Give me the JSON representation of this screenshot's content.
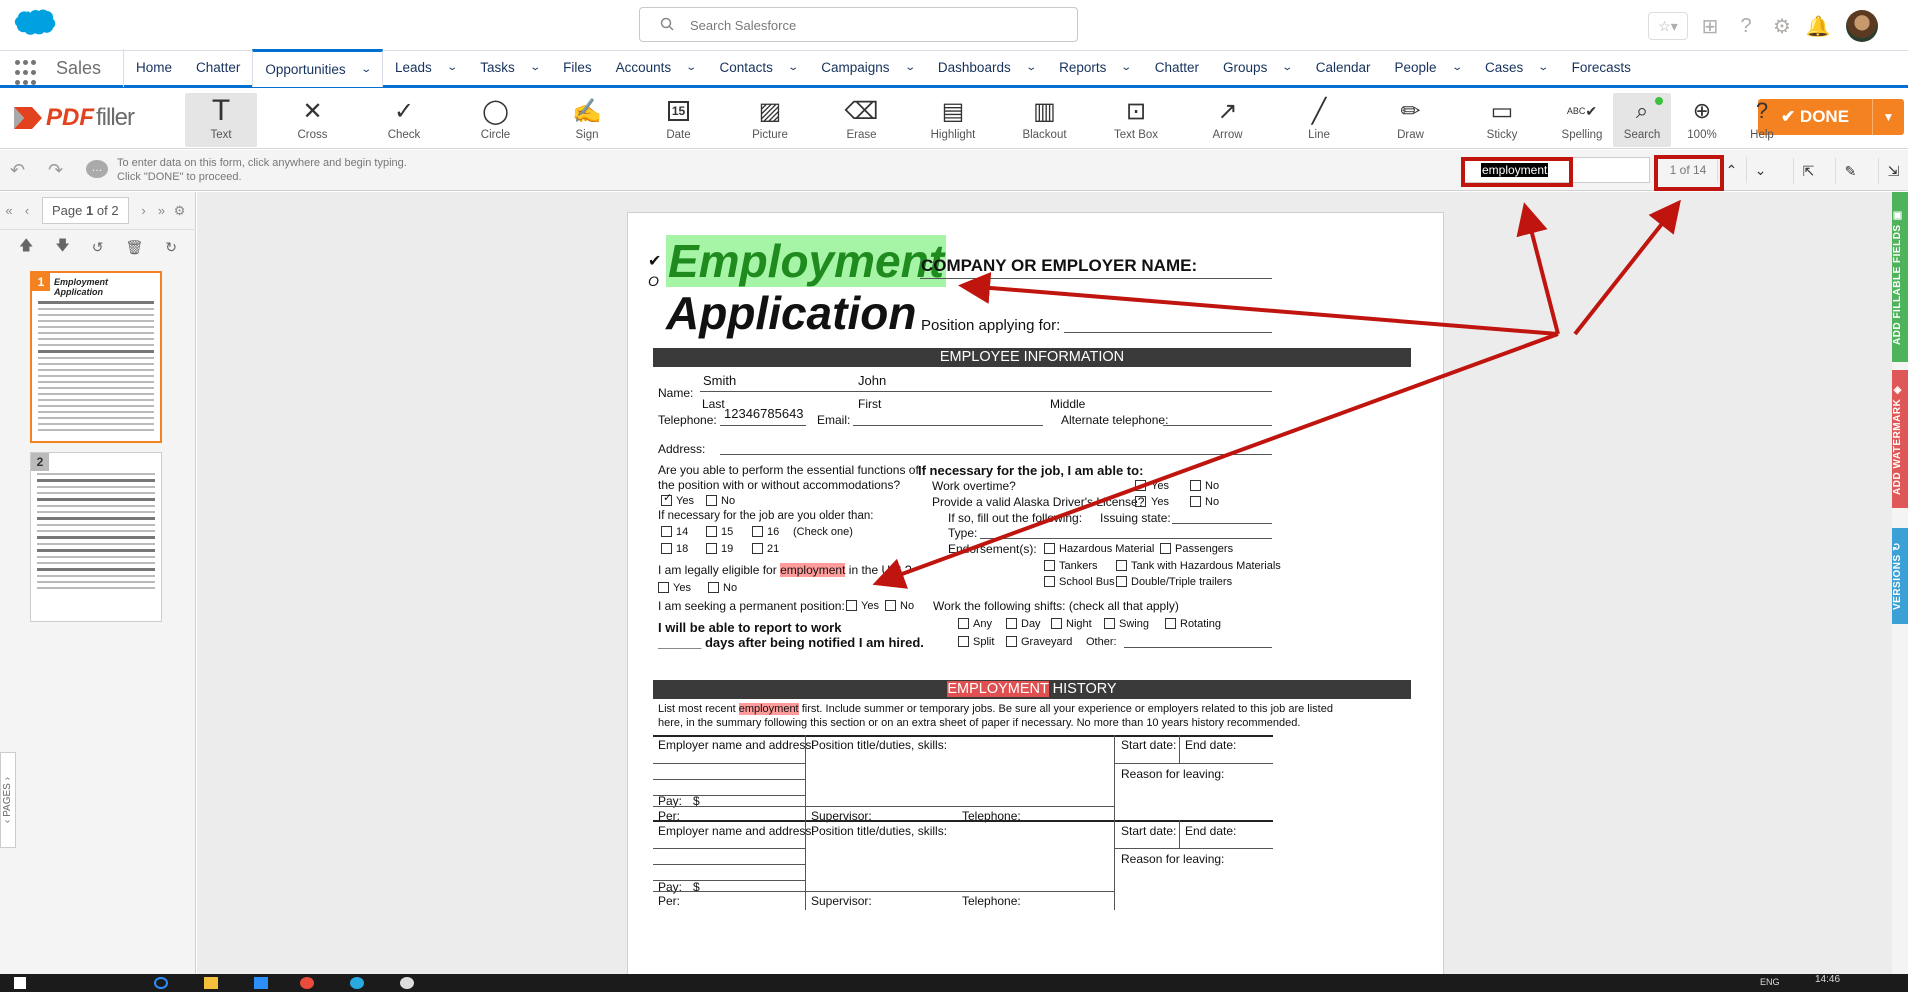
{
  "header": {
    "search_placeholder": "Search Salesforce",
    "app_name": "Sales"
  },
  "nav": [
    {
      "label": "Home",
      "dropdown": false
    },
    {
      "label": "Chatter",
      "dropdown": false
    },
    {
      "label": "Opportunities",
      "dropdown": true,
      "active": true
    },
    {
      "label": "Leads",
      "dropdown": true
    },
    {
      "label": "Tasks",
      "dropdown": true
    },
    {
      "label": "Files",
      "dropdown": false
    },
    {
      "label": "Accounts",
      "dropdown": true
    },
    {
      "label": "Contacts",
      "dropdown": true
    },
    {
      "label": "Campaigns",
      "dropdown": true
    },
    {
      "label": "Dashboards",
      "dropdown": true
    },
    {
      "label": "Reports",
      "dropdown": true
    },
    {
      "label": "Chatter",
      "dropdown": false
    },
    {
      "label": "Groups",
      "dropdown": true
    },
    {
      "label": "Calendar",
      "dropdown": false
    },
    {
      "label": "People",
      "dropdown": true
    },
    {
      "label": "Cases",
      "dropdown": true
    },
    {
      "label": "Forecasts",
      "dropdown": false
    }
  ],
  "pdffiller": {
    "logo_pdf": "PDF",
    "logo_filler": "filler",
    "tools": [
      "Text",
      "Cross",
      "Check",
      "Circle",
      "Sign",
      "Date",
      "Picture",
      "Erase",
      "Highlight",
      "Blackout",
      "Text Box",
      "Arrow",
      "Line",
      "Draw",
      "Sticky"
    ],
    "right_tools": [
      "Spelling",
      "Search",
      "100%",
      "Help"
    ],
    "spelling_badge": "ABC",
    "date_icon_num": "15",
    "done_label": "DONE",
    "hint_line1": "To enter data on this form, click anywhere and begin typing.",
    "hint_line2": "Click \"DONE\" to proceed.",
    "search_value": "employment",
    "search_count": "1 of 14"
  },
  "left_panel": {
    "page_label": "Page",
    "page_current": "1",
    "page_of": "of 2",
    "pages_tab": "PAGES",
    "thumb_numbers": [
      "1",
      "2"
    ],
    "thumb1_title_a": "Employment",
    "thumb1_title_b": "Application"
  },
  "right_tabs": [
    "ADD FILLABLE FIELDS",
    "ADD WATERMARK",
    "VERSIONS"
  ],
  "right_tab_colors": [
    "#4fb35b",
    "#e05757",
    "#3aa0d5"
  ],
  "doc": {
    "title1": "Employment",
    "title2": "Application",
    "employer_label": "COMPANY OR EMPLOYER NAME:",
    "position_label": "Position applying for:",
    "section1": "EMPLOYEE INFORMATION",
    "name_label": "Name:",
    "last_value": "Smith",
    "first_value": "John",
    "last": "Last",
    "first": "First",
    "middle": "Middle",
    "telephone_label": "Telephone:",
    "telephone_value": "12346785643",
    "email_label": "Email:",
    "alt_phone_label": "Alternate telephone:",
    "address_label": "Address:",
    "q_able_1": "Are you able to perform the essential functions of",
    "q_able_2": "the position with or without accommodations?",
    "yes": "Yes",
    "no": "No",
    "q_older": "If necessary for the job are you older than:",
    "ages": [
      "14",
      "15",
      "16",
      "18",
      "19",
      "21"
    ],
    "check_one": "(Check one)",
    "q_eligible_a": "I am legally eligible for",
    "q_eligible_hl": "employment",
    "q_eligible_b": "in the U.S.?",
    "q_permanent": "I am seeking a permanent position:",
    "report_1": "I will be able to report to work",
    "report_2": "______ days after being notified I am hired.",
    "job_head": "If necessary for the job, I am able to:",
    "overtime": "Work overtime?",
    "license": "Provide a valid Alaska Driver's License?",
    "fill_out": "If so, fill out the following:",
    "issuing": "Issuing state:",
    "type": "Type:",
    "endorse": "Endorsement(s):",
    "endorsements": [
      "Hazardous Material",
      "Passengers",
      "Tankers",
      "Tank with Hazardous Materials",
      "School Bus",
      "Double/Triple trailers"
    ],
    "shifts_label": "Work the following shifts: (check all that apply)",
    "shifts": [
      "Any",
      "Day",
      "Night",
      "Swing",
      "Rotating",
      "Split",
      "Graveyard"
    ],
    "other": "Other:",
    "section2_hl": "EMPLOYMENT",
    "section2_rest": "HISTORY",
    "list_a": "List most recent",
    "list_hl": "employment",
    "list_b": "first. Include summer or temporary jobs. Be sure all your experience or employers related to this job are listed",
    "list_c": "here, in the summary following this section or on an extra sheet of paper if necessary. No more than 10 years history recommended.",
    "emp_name": "Employer name and address:",
    "position_duties": "Position title/duties, skills:",
    "start": "Start date:",
    "end": "End date:",
    "reason": "Reason for leaving:",
    "pay": "Pay:",
    "dollar": "$",
    "per": "Per:",
    "supervisor": "Supervisor:",
    "telephone2": "Telephone:"
  },
  "taskbar": {
    "lang": "ENG",
    "time": "14:46"
  }
}
